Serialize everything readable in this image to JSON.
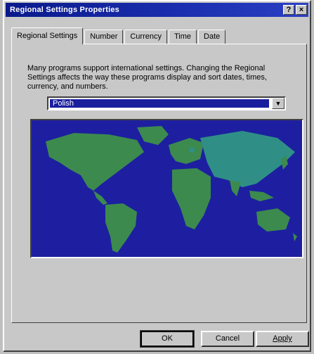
{
  "window": {
    "title": "Regional Settings Properties",
    "help_glyph": "?",
    "close_glyph": "×"
  },
  "tabs": [
    {
      "label": "Regional Settings",
      "active": true
    },
    {
      "label": "Number"
    },
    {
      "label": "Currency"
    },
    {
      "label": "Time"
    },
    {
      "label": "Date"
    }
  ],
  "panel": {
    "description": "Many programs support international settings. Changing the Regional Settings affects the way these programs display and sort dates, times, currency, and numbers.",
    "locale_value": "Polish",
    "dropdown_icon": "chevron-down-icon"
  },
  "buttons": {
    "ok": "OK",
    "cancel": "Cancel",
    "apply": "Apply"
  },
  "colors": {
    "titlebar": "#1b2fb0",
    "ocean": "#1d1fa0",
    "land": "#3c8a4e",
    "selected_region": "#2f8f86"
  }
}
